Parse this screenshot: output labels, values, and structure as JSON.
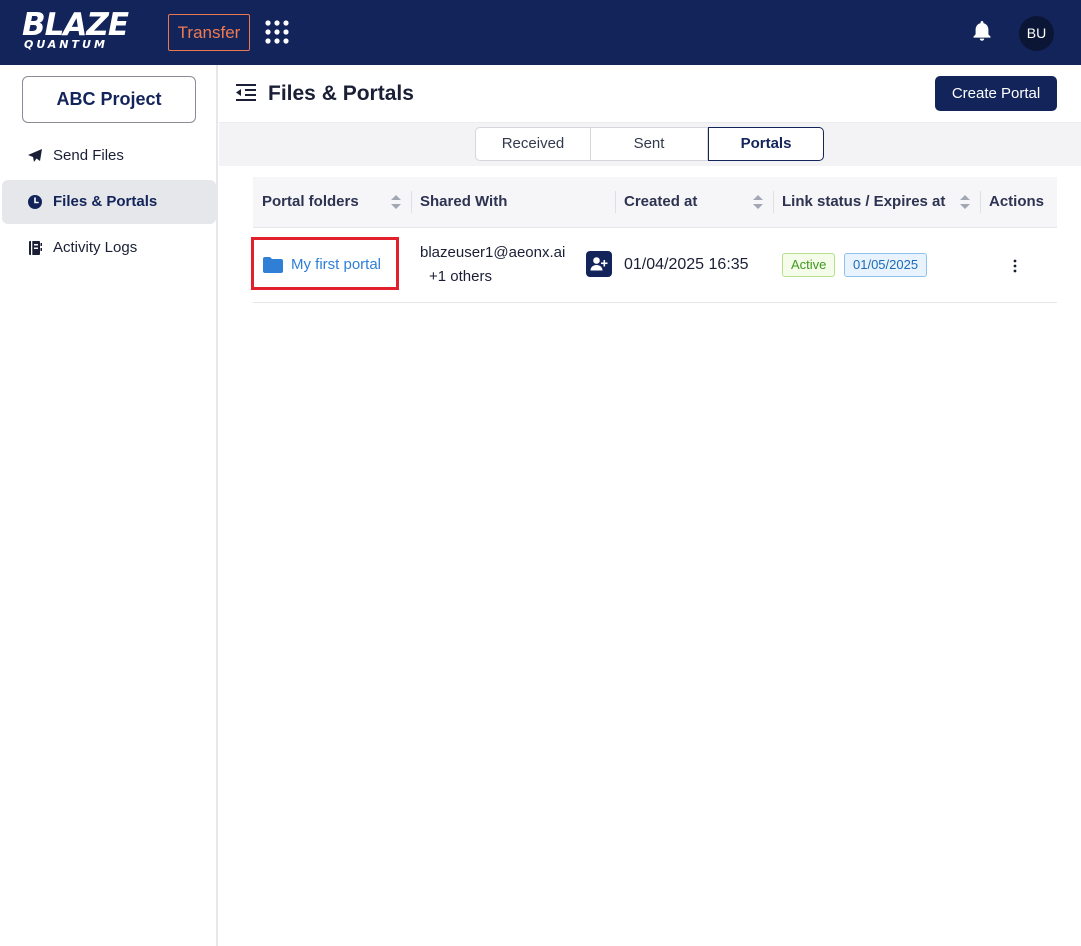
{
  "header": {
    "logo_main": "BLAZE",
    "logo_sub": "QUANTUM",
    "product_label": "Transfer",
    "avatar_initials": "BU"
  },
  "sidebar": {
    "project_label": "ABC Project",
    "items": [
      {
        "label": "Send Files",
        "icon": "paper-plane-icon",
        "active": false
      },
      {
        "label": "Files & Portals",
        "icon": "clock-icon",
        "active": true
      },
      {
        "label": "Activity Logs",
        "icon": "log-book-icon",
        "active": false
      }
    ]
  },
  "main": {
    "title": "Files & Portals",
    "create_label": "Create Portal",
    "tabs": [
      {
        "label": "Received",
        "active": false
      },
      {
        "label": "Sent",
        "active": false
      },
      {
        "label": "Portals",
        "active": true
      }
    ]
  },
  "table": {
    "columns": [
      "Portal folders",
      "Shared With",
      "Created at",
      "Link status / Expires at",
      "Actions"
    ],
    "rows": [
      {
        "name": "My first portal",
        "shared_email": "blazeuser1@aeonx.ai",
        "shared_more": "+1 others",
        "created": "01/04/2025 16:35",
        "status": "Active",
        "expires": "01/05/2025"
      }
    ]
  },
  "colors": {
    "brand_navy": "#13245a",
    "accent_orange": "#f07a50",
    "link_blue": "#2f7fd6",
    "highlight_red": "#e0202a",
    "status_green": "#3d9a1b"
  }
}
